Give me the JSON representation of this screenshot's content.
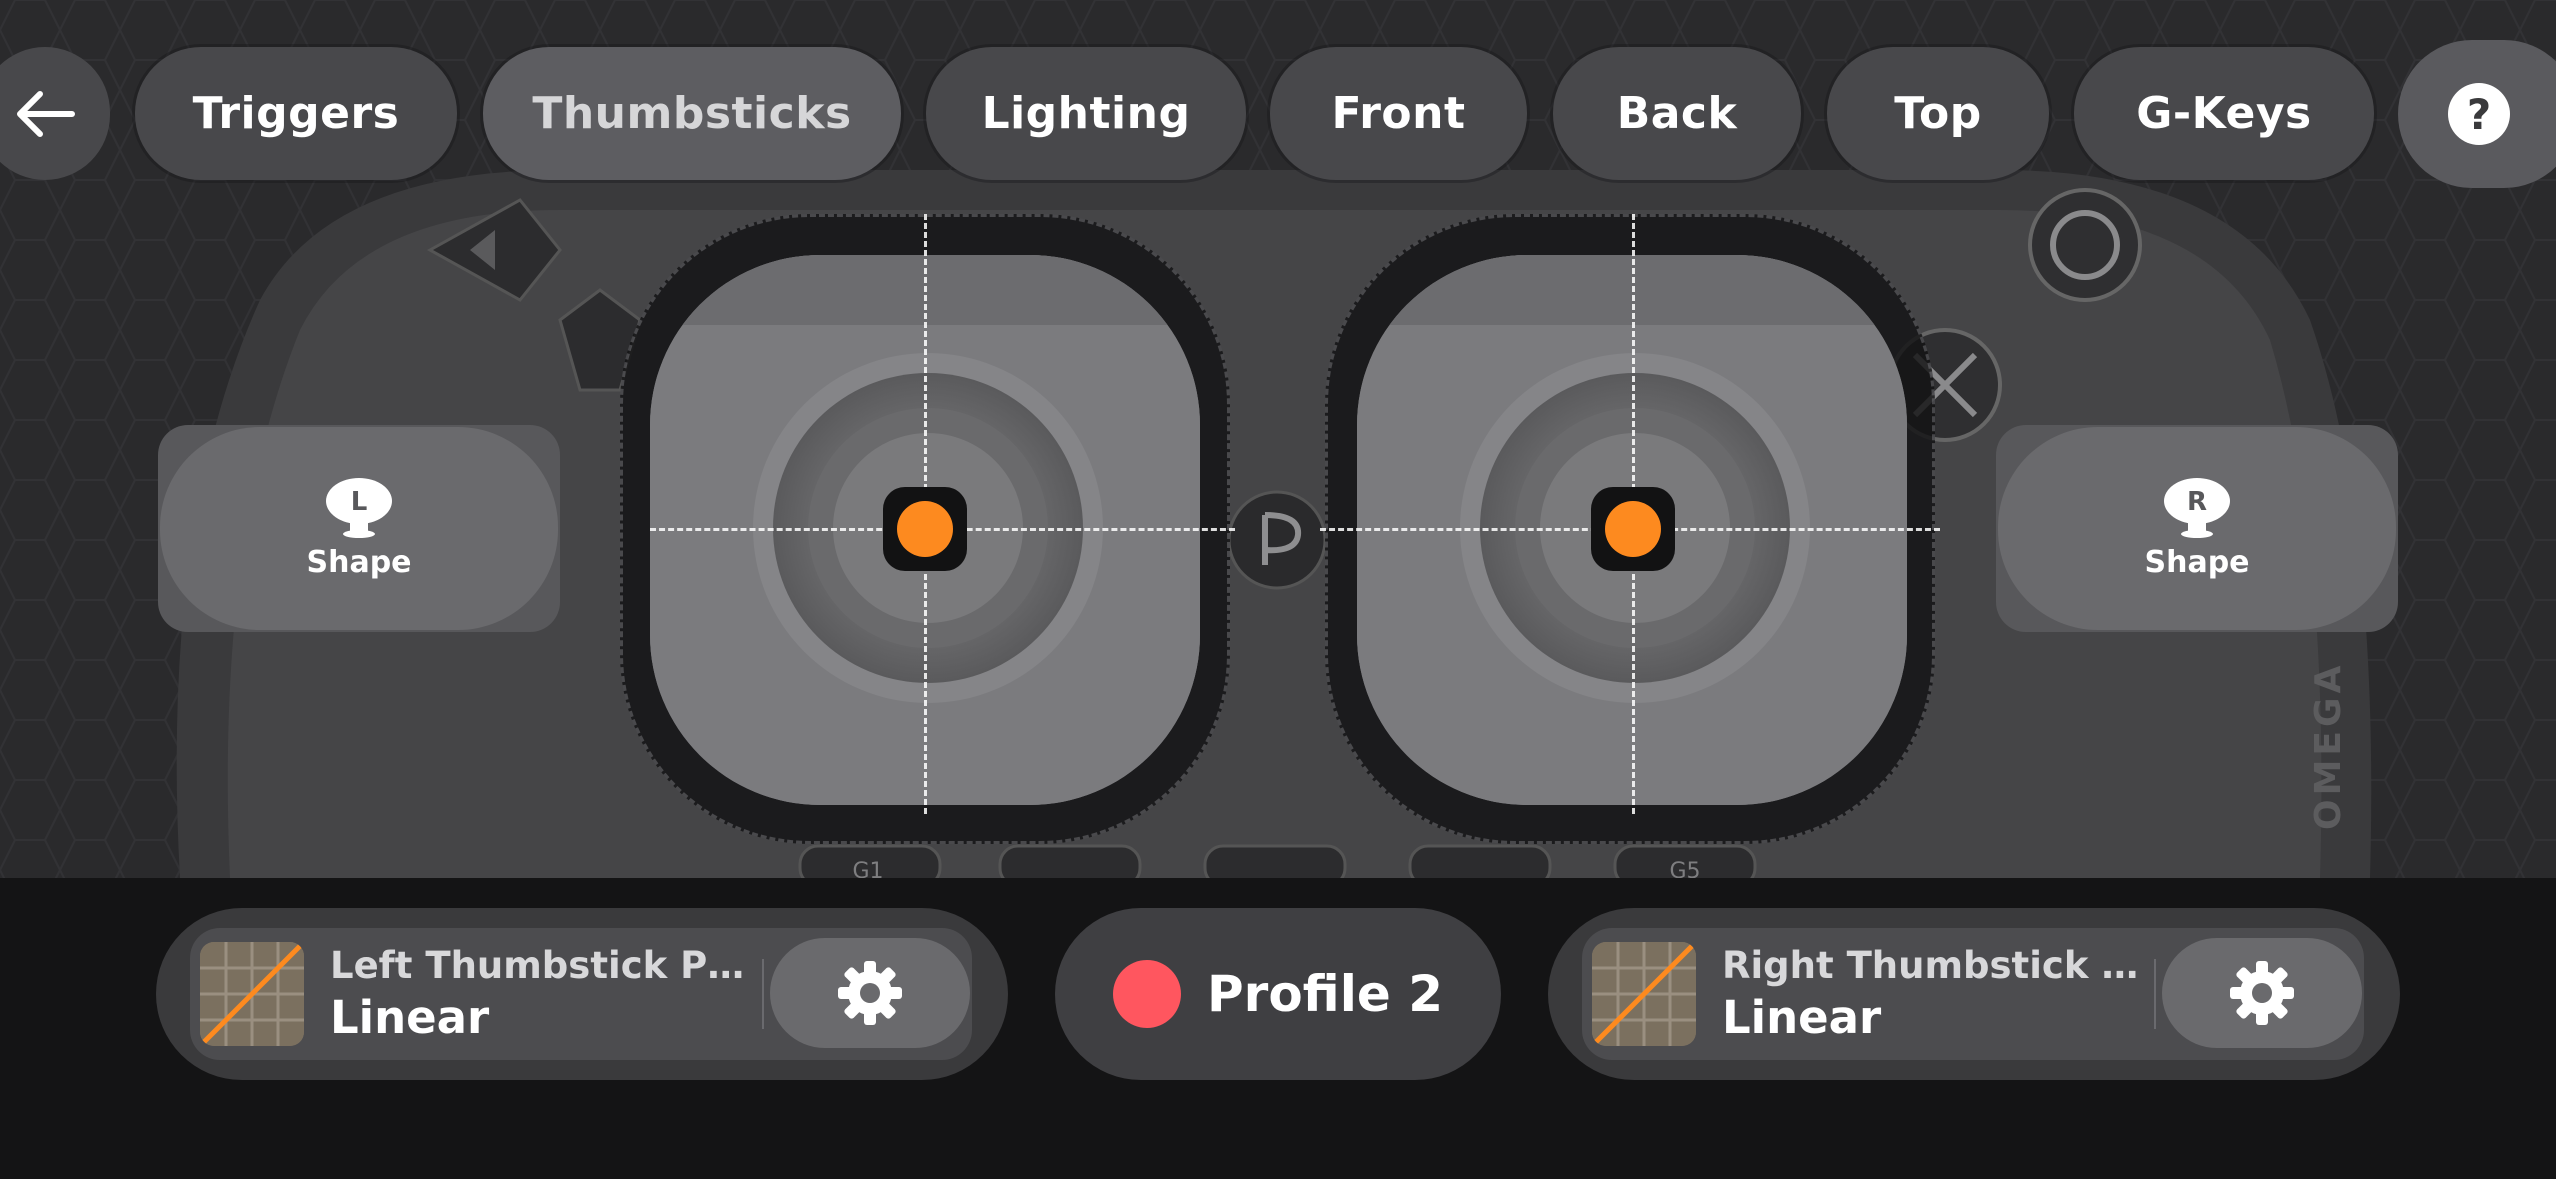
{
  "nav": {
    "tabs": [
      {
        "label": "Triggers"
      },
      {
        "label": "Thumbsticks",
        "active": true
      },
      {
        "label": "Lighting"
      },
      {
        "label": "Front"
      },
      {
        "label": "Back"
      },
      {
        "label": "Top"
      },
      {
        "label": "G-Keys"
      }
    ],
    "help_glyph": "?"
  },
  "shape_buttons": {
    "left": {
      "badge": "L",
      "label": "Shape"
    },
    "right": {
      "badge": "R",
      "label": "Shape"
    }
  },
  "background_labels": {
    "g1": "G1",
    "g5": "G5",
    "brand": "OMEGA"
  },
  "presets": {
    "left": {
      "title": "Left Thumbstick Pre...",
      "value": "Linear"
    },
    "right": {
      "title": "Right Thumbstick P...",
      "value": "Linear"
    }
  },
  "profile": {
    "label": "Profile 2",
    "color": "#ff565f"
  },
  "colors": {
    "accent": "#fd8a1f",
    "profile": "#ff565f",
    "pill": "#48484b",
    "pill_active": "#5d5d61"
  },
  "icons": [
    "back-arrow-icon",
    "help-icon",
    "left-stick-icon",
    "right-stick-icon",
    "gear-icon",
    "curve-graph-icon",
    "playstation-logo-icon"
  ]
}
